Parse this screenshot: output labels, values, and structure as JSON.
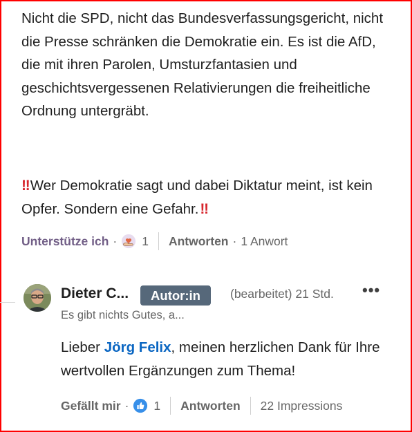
{
  "post": {
    "paragraph": "Nicht die SPD, nicht das Bundesverfassungsgericht, nicht die Presse schränken die Demokratie ein. Es ist die AfD, die mit ihren Parolen, Umsturzfantasien und geschichtsvergessenen Relativierungen die freiheitliche Ordnung untergräbt.",
    "warning_text": "Wer Demokratie sagt und dabei Diktatur meint, ist kein Opfer. Sondern eine Gefahr.",
    "warning_emoji": "‼"
  },
  "post_actions": {
    "reaction_label": "Unterstütze ich",
    "reaction_icon": "heart-hand-icon",
    "reaction_count": "1",
    "reply_label": "Antworten",
    "reply_count": "1 Anwort"
  },
  "comment": {
    "author": "Dieter C...",
    "badge": "Autor:in",
    "edited": "(bearbeitet)",
    "time": "21 Std.",
    "headline": "Es gibt nichts Gutes, a...",
    "text_before": "Lieber ",
    "mention": "Jörg Felix",
    "text_after": ", meinen herzlichen Dank für Ihre wertvollen Ergänzungen zum Thema!",
    "actions": {
      "like_label": "Gefällt mir",
      "like_icon": "thumbs-up-icon",
      "like_count": "1",
      "reply_label": "Antworten",
      "impressions": "22 Impressions"
    }
  },
  "colors": {
    "frame": "#ff0000",
    "badge": "#56687a",
    "mention": "#0a66c2",
    "support": "#715e86",
    "warning": "#d7262d"
  }
}
